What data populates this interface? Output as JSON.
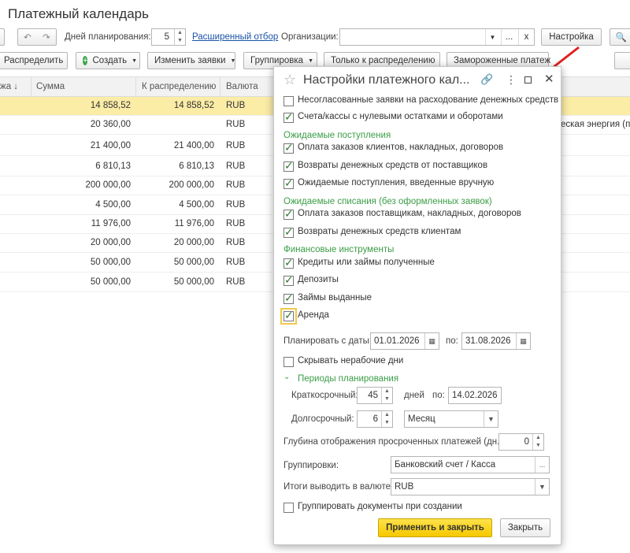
{
  "page": {
    "title": "Платежный календарь",
    "toolbar1": {
      "days_label": "Дней планирования:",
      "days_value": "5",
      "extended_filter": "Расширенный отбор",
      "org_label": "Организации:",
      "org_clear": "x",
      "org_more": "...",
      "settings_btn": "Настройка"
    },
    "toolbar2": {
      "distribute_btn": "Распределить",
      "create_btn": "Создать",
      "change_requests_btn": "Изменить заявки",
      "grouping_btn": "Группировка",
      "only_to_distribute_btn": "Только к распределению",
      "frozen_btn": "Замороженные платеж"
    },
    "grid": {
      "columns": [
        "жа",
        "Сумма",
        "К распределению",
        "Валюта"
      ],
      "rows": [
        {
          "sum": "14 858,52",
          "dist": "14 858,52",
          "cur": "RUB",
          "extra": ""
        },
        {
          "sum": "20 360,00",
          "dist": "",
          "cur": "RUB",
          "extra": "еская энергия (п."
        },
        {
          "sum": "21 400,00",
          "dist": "21 400,00",
          "cur": "RUB",
          "extra": ""
        },
        {
          "sum": "6 810,13",
          "dist": "6 810,13",
          "cur": "RUB",
          "extra": ""
        },
        {
          "sum": "200 000,00",
          "dist": "200 000,00",
          "cur": "RUB",
          "extra": ""
        },
        {
          "sum": "4 500,00",
          "dist": "4 500,00",
          "cur": "RUB",
          "extra": ""
        },
        {
          "sum": "11 976,00",
          "dist": "11 976,00",
          "cur": "RUB",
          "extra": ""
        },
        {
          "sum": "20 000,00",
          "dist": "20 000,00",
          "cur": "RUB",
          "extra": ""
        },
        {
          "sum": "50 000,00",
          "dist": "50 000,00",
          "cur": "RUB",
          "extra": ""
        },
        {
          "sum": "50 000,00",
          "dist": "50 000,00",
          "cur": "RUB",
          "extra": ""
        }
      ]
    }
  },
  "dialog": {
    "title": "Настройки платежного кал...",
    "opt_unagreed": "Несогласованные заявки на расходование денежных средств",
    "opt_zero_accounts": "Счета/кассы с нулевыми остатками и оборотами",
    "sect_income": "Ожидаемые поступления",
    "opt_customer_orders": "Оплата заказов клиентов, накладных, договоров",
    "opt_supplier_returns": "Возвраты денежных средств от поставщиков",
    "opt_manual_income": "Ожидаемые поступления, введенные вручную",
    "sect_expense": "Ожидаемые списания (без оформленных заявок)",
    "opt_supplier_orders": "Оплата заказов поставщикам, накладных, договоров",
    "opt_customer_returns": "Возвраты денежных средств клиентам",
    "sect_finance": "Финансовые инструменты",
    "opt_loans_received": "Кредиты или займы полученные",
    "opt_deposits": "Депозиты",
    "opt_loans_issued": "Займы выданные",
    "opt_rent": "Аренда",
    "plan_from_label": "Планировать с даты:",
    "plan_from": "01.01.2026",
    "plan_to_label": "по:",
    "plan_to": "31.08.2026",
    "hide_nonworking": "Скрывать нерабочие дни",
    "periods_header": "Периоды планирования",
    "short_label": "Краткосрочный:",
    "short_value": "45",
    "short_unit": "дней",
    "short_to_label": "по:",
    "short_to": "14.02.2026",
    "long_label": "Долгосрочный:",
    "long_value": "6",
    "long_unit": "Месяц",
    "overdue_label": "Глубина отображения просроченных платежей (дн.):",
    "overdue_value": "0",
    "groupings_label": "Группировки:",
    "groupings_value": "Банковский счет / Касса",
    "totals_label": "Итоги выводить в валюте:",
    "totals_value": "RUB",
    "group_docs": "Группировать документы при создании",
    "apply_btn": "Применить и закрыть",
    "close_btn": "Закрыть"
  }
}
